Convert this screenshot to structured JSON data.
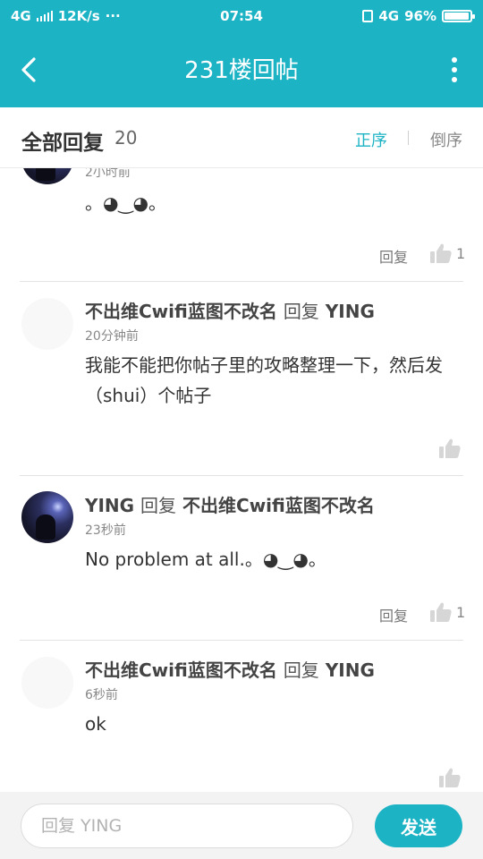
{
  "status_bar": {
    "network_left": "4G",
    "speed": "12K/s",
    "more": "···",
    "time": "07:54",
    "network_right": "4G",
    "battery": "96%",
    "battery_level": 0.96
  },
  "app_bar": {
    "title": "231楼回帖",
    "back_icon": "chevron-left-icon",
    "more_icon": "more-vertical-icon"
  },
  "subheader": {
    "label": "全部回复",
    "count": "20",
    "sort_asc": "正序",
    "sort_desc": "倒序",
    "active_color": "#1cb3c5"
  },
  "replies": [
    {
      "author": "",
      "reply_word": "",
      "target": "",
      "time": "2小时前",
      "content": "。◕‿◕。",
      "reply_label": "回复",
      "likes": "1",
      "avatar": "photo"
    },
    {
      "author": "不出维Cwifi蓝图不改名",
      "reply_word": "回复",
      "target": "YING",
      "time": "20分钟前",
      "content": "我能不能把你帖子里的攻略整理一下，然后发（shui）个帖子",
      "reply_label": "",
      "likes": "",
      "avatar": "blank"
    },
    {
      "author": "YING",
      "reply_word": "回复",
      "target": "不出维Cwifi蓝图不改名",
      "time": "23秒前",
      "content": "No problem at all.。◕‿◕。",
      "reply_label": "回复",
      "likes": "1",
      "avatar": "photo"
    },
    {
      "author": "不出维Cwifi蓝图不改名",
      "reply_word": "回复",
      "target": "YING",
      "time": "6秒前",
      "content": "ok",
      "reply_label": "",
      "likes": "",
      "avatar": "blank"
    }
  ],
  "composer": {
    "placeholder": "回复 YING",
    "value": "",
    "send_label": "发送"
  },
  "colors": {
    "brand": "#1cb3c5",
    "divider": "#e3e3e3"
  }
}
